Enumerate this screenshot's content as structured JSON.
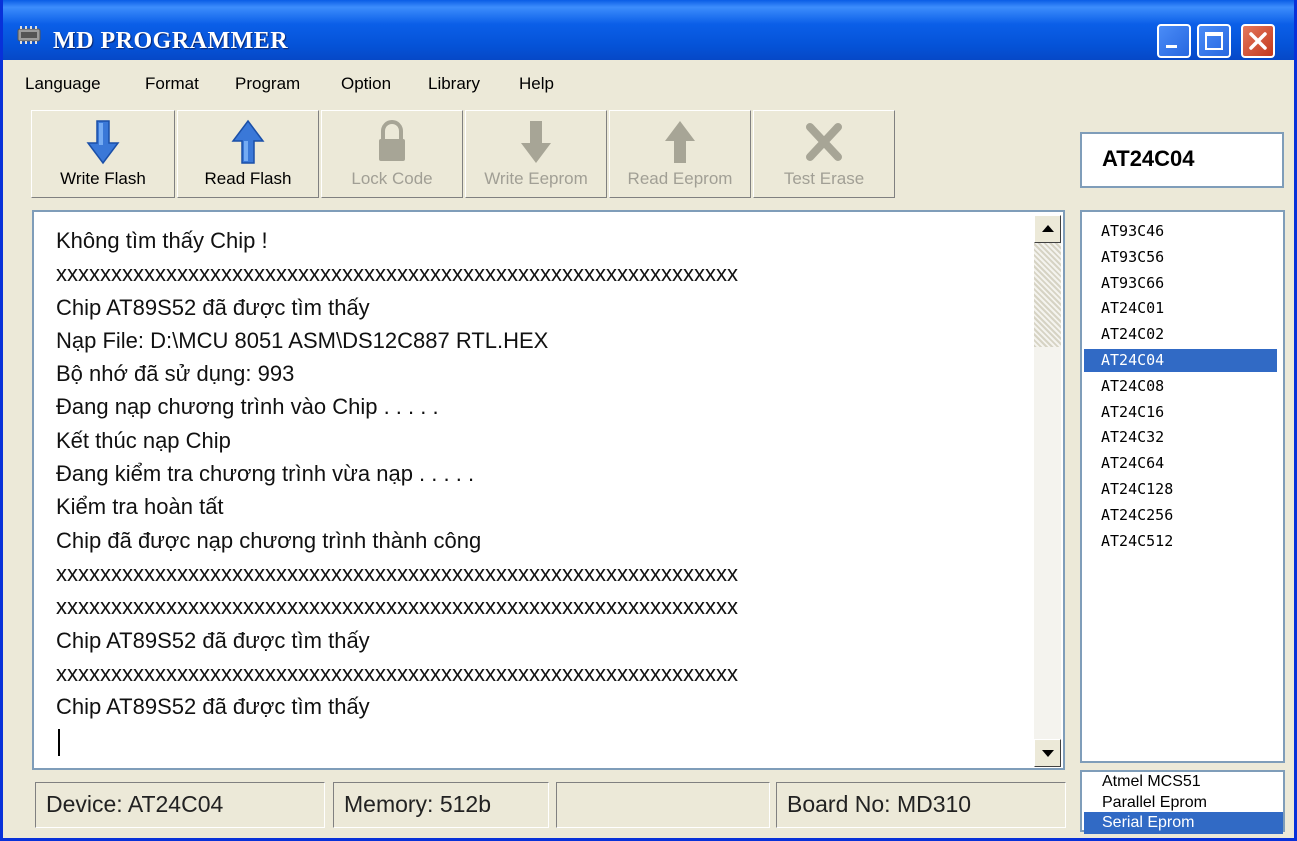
{
  "window": {
    "title": "MD PROGRAMMER"
  },
  "menu": [
    "Language",
    "Format",
    "Program",
    "Option",
    "Library",
    "Help"
  ],
  "toolbar": [
    {
      "label": "Write Flash",
      "icon": "arrow-down-icon",
      "enabled": true
    },
    {
      "label": "Read Flash",
      "icon": "arrow-up-icon",
      "enabled": true
    },
    {
      "label": "Lock Code",
      "icon": "lock-icon",
      "enabled": false
    },
    {
      "label": "Write Eeprom",
      "icon": "arrow-down-icon",
      "enabled": false
    },
    {
      "label": "Read Eeprom",
      "icon": "arrow-up-icon",
      "enabled": false
    },
    {
      "label": "Test Erase",
      "icon": "x-icon",
      "enabled": false
    }
  ],
  "selected_device": "AT24C04",
  "log": [
    "Không tìm thấy Chip !",
    "xxxxxxxxxxxxxxxxxxxxxxxxxxxxxxxxxxxxxxxxxxxxxxxxxxxxxxxxxxxxxx",
    "Chip AT89S52 đã được tìm thấy",
    "Nạp File: D:\\MCU 8051 ASM\\DS12C887 RTL.HEX",
    "Bộ nhớ đã sử dụng: 993",
    "Đang nạp chương trình vào Chip . . . . .",
    "Kết thúc nạp Chip",
    "Đang kiểm tra chương trình vừa nạp . . . . .",
    "Kiểm tra hoàn tất",
    "Chip đã được nạp chương trình thành công",
    "xxxxxxxxxxxxxxxxxxxxxxxxxxxxxxxxxxxxxxxxxxxxxxxxxxxxxxxxxxxxxx",
    "xxxxxxxxxxxxxxxxxxxxxxxxxxxxxxxxxxxxxxxxxxxxxxxxxxxxxxxxxxxxxx",
    "Chip AT89S52 đã được tìm thấy",
    "xxxxxxxxxxxxxxxxxxxxxxxxxxxxxxxxxxxxxxxxxxxxxxxxxxxxxxxxxxxxxx",
    "Chip AT89S52 đã được tìm thấy"
  ],
  "chips": [
    "AT93C46",
    "AT93C56",
    "AT93C66",
    "AT24C01",
    "AT24C02",
    "AT24C04",
    "AT24C08",
    "AT24C16",
    "AT24C32",
    "AT24C64",
    "AT24C128",
    "AT24C256",
    "AT24C512"
  ],
  "chips_selected": "AT24C04",
  "families": [
    "Atmel MCS51",
    "Parallel Eprom",
    "Serial Eprom"
  ],
  "families_selected": "Serial Eprom",
  "status": {
    "device": "Device:  AT24C04",
    "memory": "Memory: 512b",
    "empty": "",
    "board": "Board No: MD310"
  },
  "colors": {
    "titlebar": "#0553d8",
    "selection": "#316ac5",
    "close": "#c4391c",
    "toolbar_arrow": "#3a78d8",
    "disabled": "#a19f95"
  }
}
